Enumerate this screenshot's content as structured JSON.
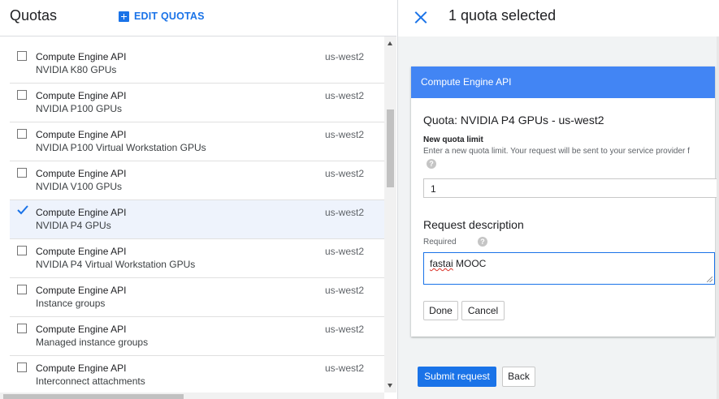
{
  "left_pane": {
    "title": "Quotas",
    "edit_quotas_label": "EDIT QUOTAS",
    "rows": [
      {
        "service": "Compute Engine API",
        "metric": "NVIDIA K80 GPUs",
        "region": "us-west2",
        "checked": false
      },
      {
        "service": "Compute Engine API",
        "metric": "NVIDIA P100 GPUs",
        "region": "us-west2",
        "checked": false
      },
      {
        "service": "Compute Engine API",
        "metric": "NVIDIA P100 Virtual Workstation GPUs",
        "region": "us-west2",
        "checked": false
      },
      {
        "service": "Compute Engine API",
        "metric": "NVIDIA V100 GPUs",
        "region": "us-west2",
        "checked": false
      },
      {
        "service": "Compute Engine API",
        "metric": "NVIDIA P4 GPUs",
        "region": "us-west2",
        "checked": true
      },
      {
        "service": "Compute Engine API",
        "metric": "NVIDIA P4 Virtual Workstation GPUs",
        "region": "us-west2",
        "checked": false
      },
      {
        "service": "Compute Engine API",
        "metric": "Instance groups",
        "region": "us-west2",
        "checked": false
      },
      {
        "service": "Compute Engine API",
        "metric": "Managed instance groups",
        "region": "us-west2",
        "checked": false
      },
      {
        "service": "Compute Engine API",
        "metric": "Interconnect attachments",
        "region": "us-west2",
        "checked": false
      }
    ]
  },
  "right_pane": {
    "title": "1 quota selected",
    "card": {
      "service_header": "Compute Engine API",
      "quota_name": "Quota: NVIDIA P4 GPUs - us-west2",
      "new_limit_label": "New quota limit",
      "new_limit_description": "Enter a new quota limit. Your request will be sent to your service provider f",
      "new_limit_value": "1",
      "request_description_title": "Request description",
      "required_label": "Required",
      "description_misspelled_word": "fastai",
      "description_rest": " MOOC",
      "done_label": "Done",
      "cancel_label": "Cancel",
      "help_glyph": "?"
    },
    "submit_label": "Submit request",
    "back_label": "Back"
  },
  "colors": {
    "accent": "#1a73e8",
    "card_header": "#4285f4",
    "selected_row": "#eef3fc"
  }
}
